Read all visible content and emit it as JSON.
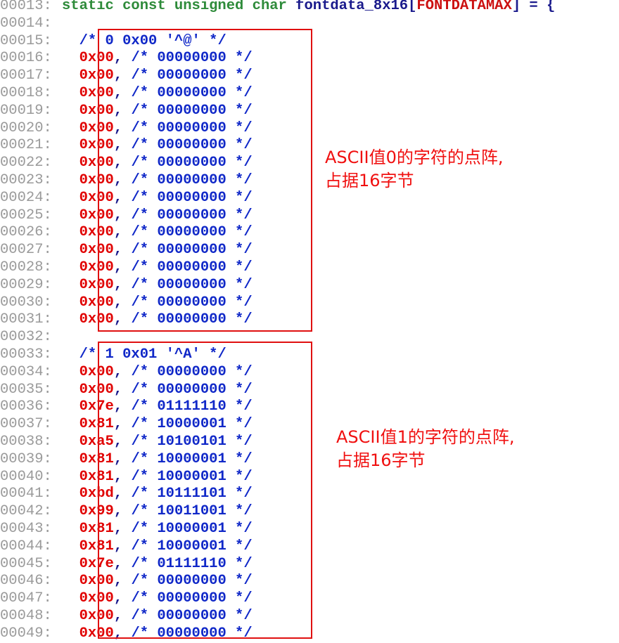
{
  "header": {
    "line_no": "00013:",
    "kw": "static const unsigned char",
    "ident": "fontdata_8x16",
    "bracket_open": "[",
    "macro": "FONTDATAMAX",
    "tail": "] = {"
  },
  "blank_lines": [
    "00014:",
    "00032:"
  ],
  "blocks": [
    {
      "comment_line_no": "00015:",
      "comment": "/* 0 0x00 '^@' */",
      "rows": [
        {
          "ln": "00016:",
          "hex": "0x00",
          "bin": "/* 00000000 */"
        },
        {
          "ln": "00017:",
          "hex": "0x00",
          "bin": "/* 00000000 */"
        },
        {
          "ln": "00018:",
          "hex": "0x00",
          "bin": "/* 00000000 */"
        },
        {
          "ln": "00019:",
          "hex": "0x00",
          "bin": "/* 00000000 */"
        },
        {
          "ln": "00020:",
          "hex": "0x00",
          "bin": "/* 00000000 */"
        },
        {
          "ln": "00021:",
          "hex": "0x00",
          "bin": "/* 00000000 */"
        },
        {
          "ln": "00022:",
          "hex": "0x00",
          "bin": "/* 00000000 */"
        },
        {
          "ln": "00023:",
          "hex": "0x00",
          "bin": "/* 00000000 */"
        },
        {
          "ln": "00024:",
          "hex": "0x00",
          "bin": "/* 00000000 */"
        },
        {
          "ln": "00025:",
          "hex": "0x00",
          "bin": "/* 00000000 */"
        },
        {
          "ln": "00026:",
          "hex": "0x00",
          "bin": "/* 00000000 */"
        },
        {
          "ln": "00027:",
          "hex": "0x00",
          "bin": "/* 00000000 */"
        },
        {
          "ln": "00028:",
          "hex": "0x00",
          "bin": "/* 00000000 */"
        },
        {
          "ln": "00029:",
          "hex": "0x00",
          "bin": "/* 00000000 */"
        },
        {
          "ln": "00030:",
          "hex": "0x00",
          "bin": "/* 00000000 */"
        },
        {
          "ln": "00031:",
          "hex": "0x00",
          "bin": "/* 00000000 */"
        }
      ],
      "annotation": "ASCII值0的字符的点阵,\n占据16字节"
    },
    {
      "comment_line_no": "00033:",
      "comment": "/* 1 0x01 '^A' */",
      "rows": [
        {
          "ln": "00034:",
          "hex": "0x00",
          "bin": "/* 00000000 */"
        },
        {
          "ln": "00035:",
          "hex": "0x00",
          "bin": "/* 00000000 */"
        },
        {
          "ln": "00036:",
          "hex": "0x7e",
          "bin": "/* 01111110 */"
        },
        {
          "ln": "00037:",
          "hex": "0x81",
          "bin": "/* 10000001 */"
        },
        {
          "ln": "00038:",
          "hex": "0xa5",
          "bin": "/* 10100101 */"
        },
        {
          "ln": "00039:",
          "hex": "0x81",
          "bin": "/* 10000001 */"
        },
        {
          "ln": "00040:",
          "hex": "0x81",
          "bin": "/* 10000001 */"
        },
        {
          "ln": "00041:",
          "hex": "0xbd",
          "bin": "/* 10111101 */"
        },
        {
          "ln": "00042:",
          "hex": "0x99",
          "bin": "/* 10011001 */"
        },
        {
          "ln": "00043:",
          "hex": "0x81",
          "bin": "/* 10000001 */"
        },
        {
          "ln": "00044:",
          "hex": "0x81",
          "bin": "/* 10000001 */"
        },
        {
          "ln": "00045:",
          "hex": "0x7e",
          "bin": "/* 01111110 */"
        },
        {
          "ln": "00046:",
          "hex": "0x00",
          "bin": "/* 00000000 */"
        },
        {
          "ln": "00047:",
          "hex": "0x00",
          "bin": "/* 00000000 */"
        },
        {
          "ln": "00048:",
          "hex": "0x00",
          "bin": "/* 00000000 */"
        },
        {
          "ln": "00049:",
          "hex": "0x00",
          "bin": "/* 00000000 */"
        }
      ],
      "annotation": "ASCII值1的字符的点阵,\n占据16字节"
    }
  ]
}
